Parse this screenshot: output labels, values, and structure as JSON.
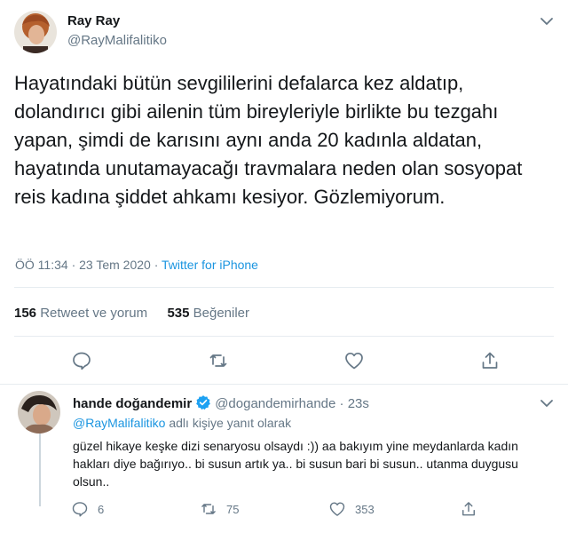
{
  "tweet": {
    "name": "Ray Ray",
    "handle": "@RayMalifalitiko",
    "text": "Hayatındaki bütün sevgililerini defalarca kez aldatıp, dolandırıcı gibi ailenin tüm bireyleriyle birlikte bu tezgahı yapan, şimdi de karısını aynı anda 20 kadınla aldatan, hayatında unutamayacağı travmalara neden olan sosyopat reis kadına şiddet ahkamı kesiyor. Gözlemiyorum.",
    "time": "ÖÖ 11:34",
    "dot": "·",
    "date": "23 Tem 2020",
    "source": "Twitter for iPhone",
    "retweets_count": "156",
    "retweets_label": "Retweet ve yorum",
    "likes_count": "535",
    "likes_label": "Beğeniler"
  },
  "reply": {
    "name": "hande doğandemir",
    "handle": "@dogandemirhande",
    "time": "· 23s",
    "reply_to_link": "@RayMalifalitiko",
    "reply_to_suffix": "adlı kişiye yanıt olarak",
    "text": "güzel hikaye keşke dizi senaryosu olsaydı :)) aa bakıyım yine meydanlarda kadın hakları diye bağırıyo.. bi susun artık ya.. bi susun bari bi susun.. utanma duygusu olsun..",
    "replies": "6",
    "retweets": "75",
    "likes": "353"
  },
  "colors": {
    "accent": "#1b95e0",
    "secondary_text": "#657786",
    "verified": "#1da1f2"
  },
  "icons": [
    "chevron-down-icon",
    "reply-icon",
    "retweet-icon",
    "like-icon",
    "share-icon",
    "verified-badge-icon"
  ]
}
